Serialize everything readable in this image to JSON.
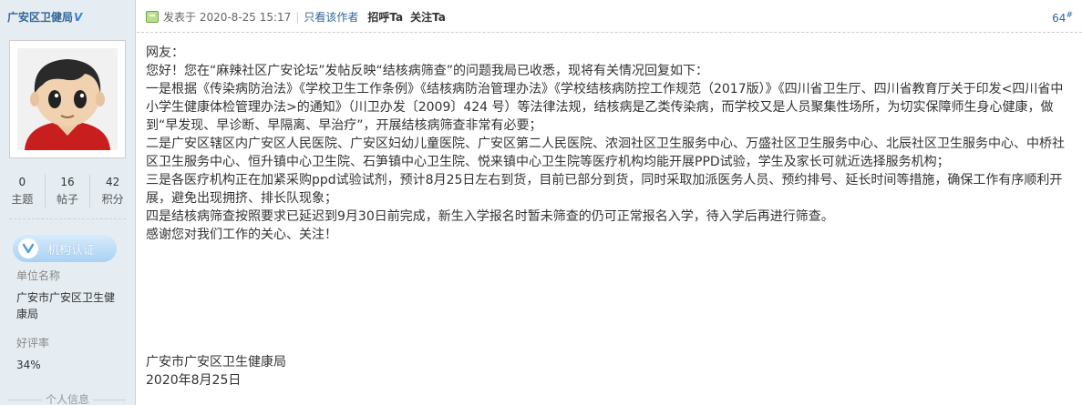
{
  "user": {
    "name": "广安区卫健局",
    "verified_mark": "V",
    "stats": [
      {
        "num": "0",
        "label": "主题"
      },
      {
        "num": "16",
        "label": "帖子"
      },
      {
        "num": "42",
        "label": "积分"
      }
    ],
    "badge_label": "机构认证",
    "unit_key": "单位名称",
    "unit_value": "广安市广安区卫生健康局",
    "rating_key": "好评率",
    "rating_value": "34%",
    "section_label": "个人信息"
  },
  "post": {
    "posted_at": "发表于 2020-8-25 15:17",
    "separator": "|",
    "only_author": "只看该作者",
    "greet": "招呼Ta",
    "follow": "关注Ta",
    "floor_number": "64",
    "floor_suffix": "#",
    "paragraphs": [
      "网友：",
      "您好！您在“麻辣社区广安论坛”发帖反映“结核病筛查”的问题我局已收悉，现将有关情况回复如下：",
      "一是根据《传染病防治法》《学校卫生工作条例》《结核病防治管理办法》《学校结核病防控工作规范（2017版）》《四川省卫生厅、四川省教育厅关于印发<四川省中小学生健康体检管理办法>的通知》（川卫办发〔2009〕424 号）等法律法规，结核病是乙类传染病，而学校又是人员聚集性场所，为切实保障师生身心健康，做到“早发现、早诊断、早隔离、早治疗”，开展结核病筛查非常有必要；",
      "二是广安区辖区内广安区人民医院、广安区妇幼儿童医院、广安区第二人民医院、浓洄社区卫生服务中心、万盛社区卫生服务中心、北辰社区卫生服务中心、中桥社区卫生服务中心、恒升镇中心卫生院、石笋镇中心卫生院、悦来镇中心卫生院等医疗机构均能开展PPD试验，学生及家长可就近选择服务机构；",
      "三是各医疗机构正在加紧采购ppd试验试剂，预计8月25日左右到货，目前已部分到货，同时采取加派医务人员、预约排号、延长时间等措施，确保工作有序顺利开展，避免出现拥挤、排长队现象；",
      "四是结核病筛查按照要求已延迟到9月30日前完成，新生入学报名时暂未筛查的仍可正常报名入学，待入学后再进行筛查。",
      "感谢您对我们工作的关心、关注！"
    ],
    "signature_org": "广安市广安区卫生健康局",
    "signature_date": "2020年8月25日"
  }
}
